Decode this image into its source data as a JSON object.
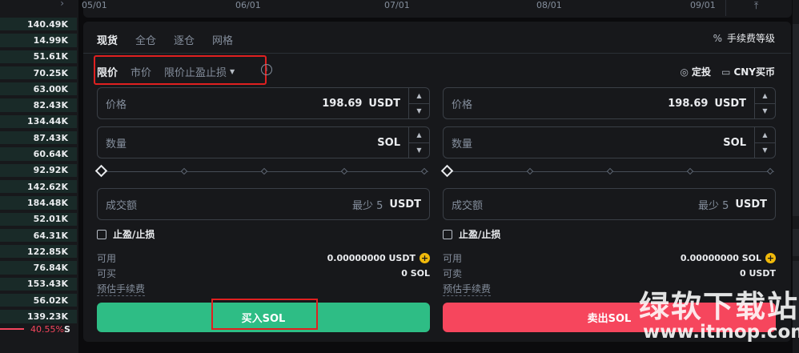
{
  "orderbook": {
    "rows": [
      {
        "value": "140.49K",
        "fill": 0.98
      },
      {
        "value": "14.99K",
        "fill": 0.98
      },
      {
        "value": "51.61K",
        "fill": 0.98
      },
      {
        "value": "70.25K",
        "fill": 0.98
      },
      {
        "value": "63.00K",
        "fill": 0.98
      },
      {
        "value": "82.43K",
        "fill": 0.98
      },
      {
        "value": "134.44K",
        "fill": 0.98
      },
      {
        "value": "87.43K",
        "fill": 0.98
      },
      {
        "value": "60.64K",
        "fill": 0.98
      },
      {
        "value": "92.92K",
        "fill": 0.98
      },
      {
        "value": "142.62K",
        "fill": 0.98
      },
      {
        "value": "184.48K",
        "fill": 0.98
      },
      {
        "value": "52.01K",
        "fill": 0.98
      },
      {
        "value": "64.31K",
        "fill": 0.98
      },
      {
        "value": "122.85K",
        "fill": 0.98
      },
      {
        "value": "76.84K",
        "fill": 0.98
      },
      {
        "value": "153.43K",
        "fill": 0.98
      },
      {
        "value": "56.02K",
        "fill": 0.98
      },
      {
        "value": "139.23K",
        "fill": 0.98
      }
    ],
    "sell_ratio": "40.55%",
    "sell_letter": "S",
    "colors": {
      "buy_bg": "#1c3a33",
      "sell": "#f6465d"
    }
  },
  "chart": {
    "dates": [
      "05/01",
      "06/01",
      "07/01",
      "08/01",
      "09/01"
    ],
    "export_icon": "export-icon"
  },
  "panel": {
    "tabs": [
      "现货",
      "全仓",
      "逐仓",
      "网格"
    ],
    "active_tab": 0,
    "fee_label": "手续费等级",
    "order_types": [
      "限价",
      "市价",
      "限价止盈止损"
    ],
    "active_order_type": 0,
    "dingtou_label": "定投",
    "cny_label": "CNY买币"
  },
  "buy": {
    "price_label": "价格",
    "price_value": "198.69",
    "price_unit": "USDT",
    "qty_label": "数量",
    "qty_unit": "SOL",
    "total_label": "成交额",
    "total_hint": "最少 5",
    "total_unit": "USDT",
    "tpsl_label": "止盈/止损",
    "available_label": "可用",
    "available_value": "0.00000000 USDT",
    "can_buy_label": "可买",
    "can_buy_value": "0 SOL",
    "fee_label": "预估手续费",
    "button_label": "买入SOL"
  },
  "sell": {
    "price_label": "价格",
    "price_value": "198.69",
    "price_unit": "USDT",
    "qty_label": "数量",
    "qty_unit": "SOL",
    "total_label": "成交额",
    "total_hint": "最少 5",
    "total_unit": "USDT",
    "tpsl_label": "止盈/止损",
    "available_label": "可用",
    "available_value": "0.00000000 SOL",
    "can_sell_label": "可卖",
    "can_sell_value": "0 USDT",
    "fee_label": "预估手续费",
    "button_label": "卖出SOL"
  },
  "watermark": {
    "title": "绿软下载站",
    "url": "www.itmop.com"
  },
  "colors": {
    "buy": "#2ebd85",
    "sell": "#f6465d",
    "accent": "#f0b90b",
    "highlight_box": "#e02020"
  }
}
